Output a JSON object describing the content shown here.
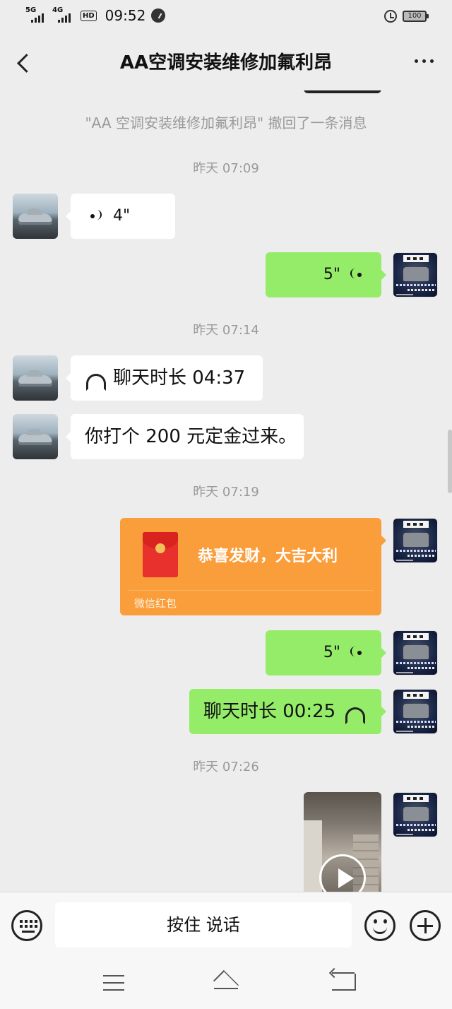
{
  "status_bar": {
    "network_1": "5G",
    "network_2": "4G",
    "hd_badge": "HD",
    "time": "09:52",
    "battery": "100"
  },
  "header": {
    "title": "AA空调安装维修加氟利昂"
  },
  "messages": {
    "recall_notice": "\"AA 空调安装维修加氟利昂\" 撤回了一条消息",
    "time_1": "昨天 07:09",
    "voice_in_duration": "4\"",
    "voice_out_duration_1": "5\"",
    "time_2": "昨天 07:14",
    "call_in_text": "聊天时长 04:37",
    "text_in": "你打个 200 元定金过来。",
    "time_3": "昨天 07:19",
    "red_packet_greeting": "恭喜发财，大吉大利",
    "red_packet_label": "微信红包",
    "voice_out_duration_2": "5\"",
    "call_out_text": "聊天时长 00:25",
    "time_4": "昨天 07:26"
  },
  "input_bar": {
    "hold_to_talk": "按住 说话"
  },
  "colors": {
    "background": "#ededed",
    "bubble_out": "#95ec69",
    "bubble_in": "#ffffff",
    "red_packet": "#fa9d3b"
  }
}
